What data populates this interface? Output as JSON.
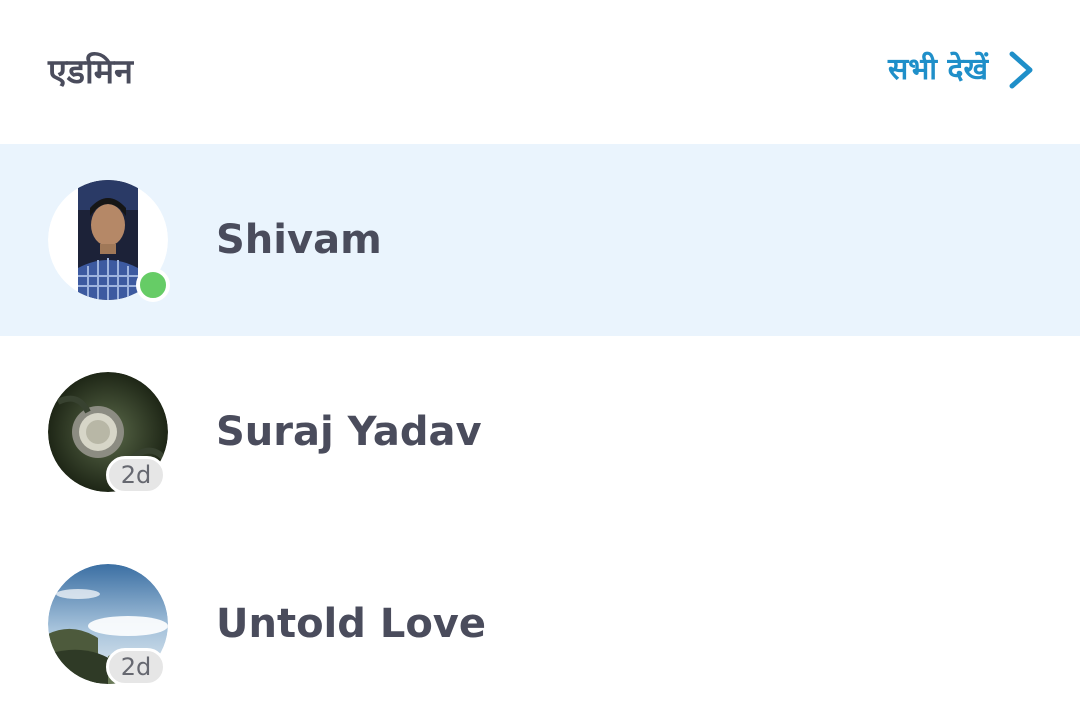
{
  "header": {
    "title": "एडमिन",
    "see_all_label": "सभी देखें",
    "see_all_icon": "chevron-right-icon",
    "accent_color": "#1f8fc9"
  },
  "members": [
    {
      "name": "Shivam",
      "status": "online",
      "highlighted": true,
      "avatar": "profile-photo"
    },
    {
      "name": "Suraj Yadav",
      "status": "away",
      "last_seen": "2d",
      "highlighted": false,
      "avatar": "aerial-photo"
    },
    {
      "name": "Untold Love",
      "status": "away",
      "last_seen": "2d",
      "highlighted": false,
      "avatar": "landscape-photo"
    }
  ],
  "colors": {
    "row_highlight": "#eaf4fd",
    "online": "#66cc66",
    "text": "#4a4c5c"
  }
}
